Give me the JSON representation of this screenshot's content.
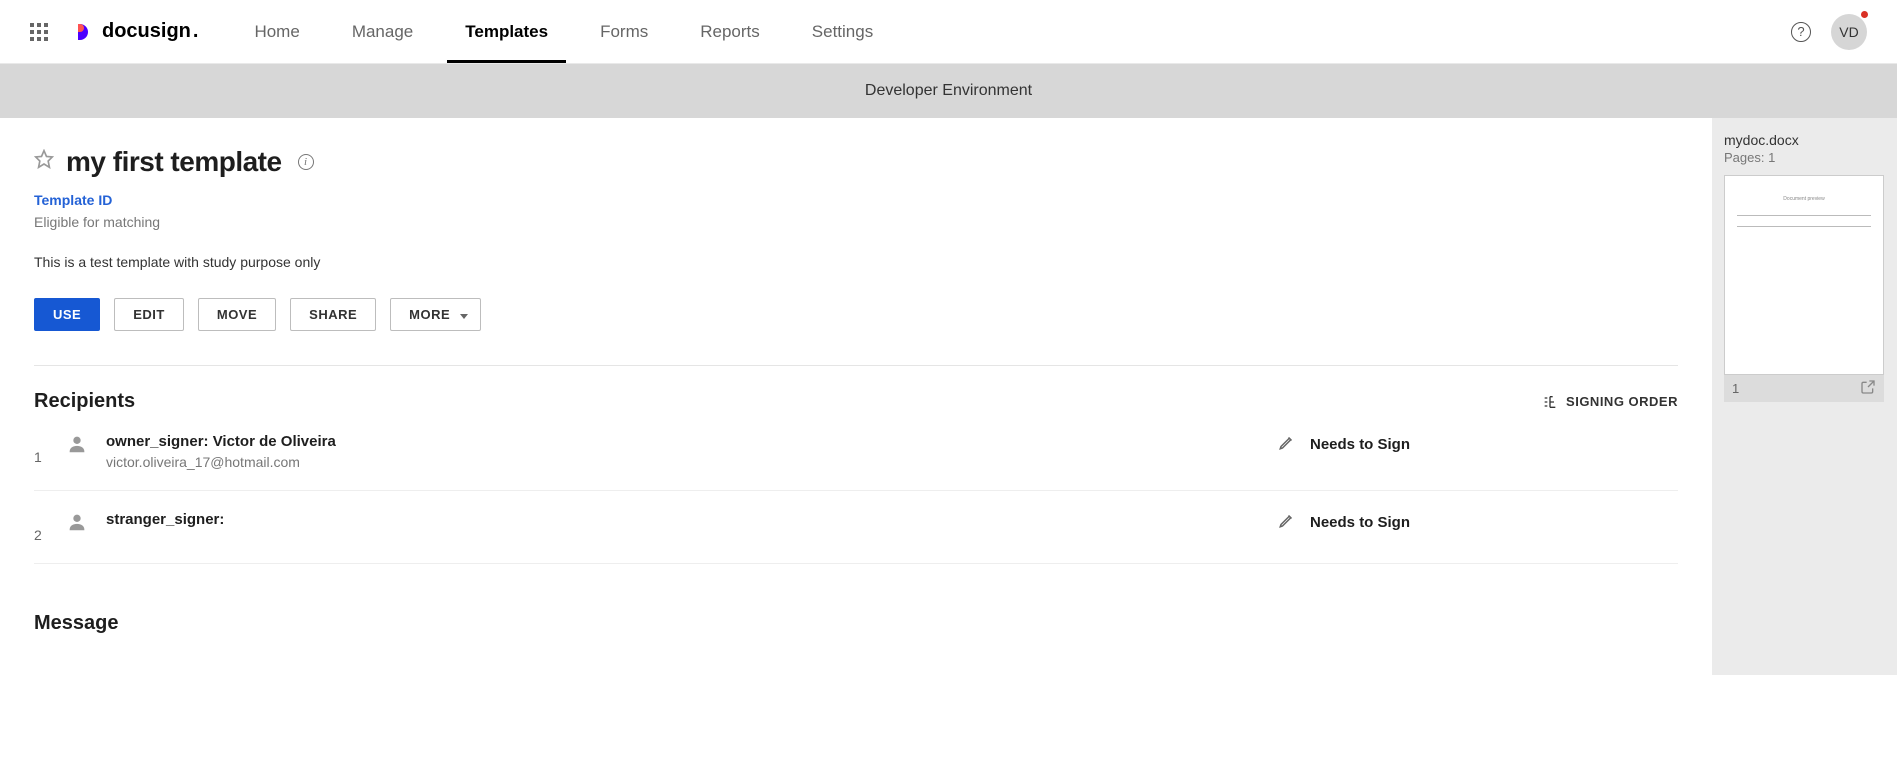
{
  "header": {
    "brand": "docusign",
    "nav": {
      "home": "Home",
      "manage": "Manage",
      "templates": "Templates",
      "forms": "Forms",
      "reports": "Reports",
      "settings": "Settings"
    },
    "avatar_initials": "VD"
  },
  "banner": "Developer Environment",
  "template": {
    "title": "my first template",
    "template_id_label": "Template ID",
    "eligible_text": "Eligible for matching",
    "description": "This is a test template with study purpose only"
  },
  "buttons": {
    "use": "USE",
    "edit": "EDIT",
    "move": "MOVE",
    "share": "SHARE",
    "more": "MORE"
  },
  "recipients": {
    "section_title": "Recipients",
    "signing_order_label": "SIGNING ORDER",
    "list": [
      {
        "index": "1",
        "name": "owner_signer: Victor de Oliveira",
        "email": "victor.oliveira_17@hotmail.com",
        "action": "Needs to Sign"
      },
      {
        "index": "2",
        "name": "stranger_signer:",
        "email": "",
        "action": "Needs to Sign"
      }
    ]
  },
  "message": {
    "section_title": "Message"
  },
  "document_panel": {
    "filename": "mydoc.docx",
    "pages_label": "Pages: 1",
    "page_number": "1"
  }
}
